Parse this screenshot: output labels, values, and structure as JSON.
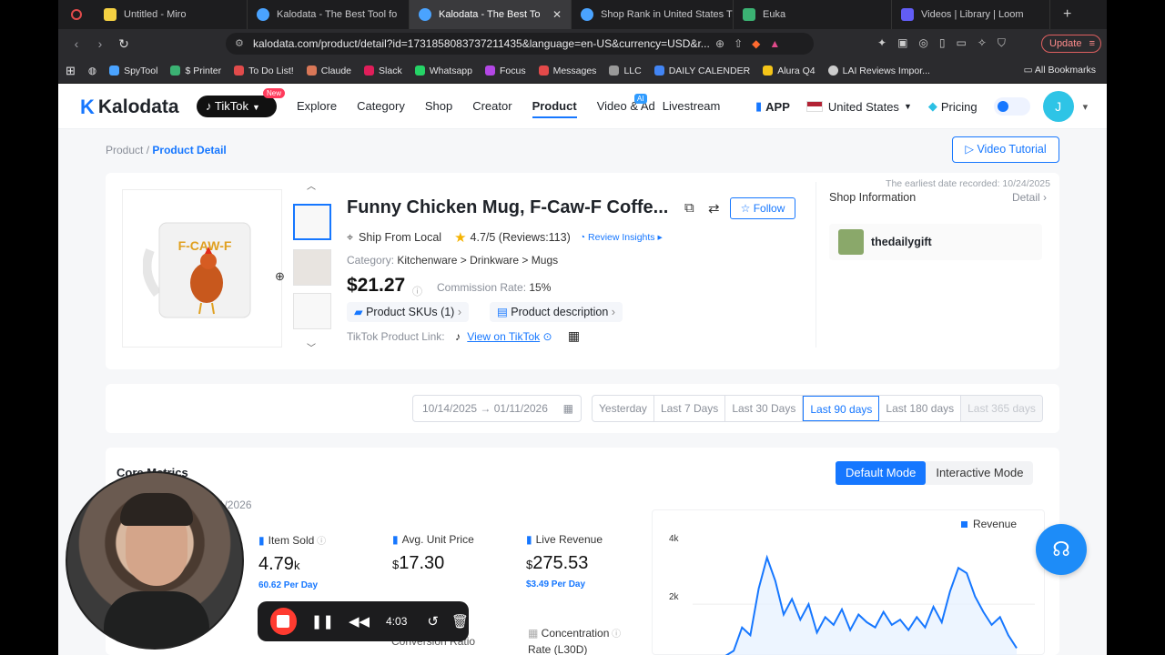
{
  "browser": {
    "tabs": [
      {
        "title": "Untitled - Miro",
        "color": "#f5d142"
      },
      {
        "title": "Kalodata - The Best Tool fo",
        "color": "#4aa3ff"
      },
      {
        "title": "Kalodata - The Best To",
        "color": "#4aa3ff",
        "active": true
      },
      {
        "title": "Shop Rank in United States Ti",
        "color": "#4aa3ff"
      },
      {
        "title": "Euka",
        "color": "#3bb273"
      },
      {
        "title": "Videos | Library | Loom",
        "color": "#625df5"
      }
    ],
    "new_tab": "+",
    "url": "kalodata.com/product/detail?id=1731858083737211435&language=en-US&currency=USD&r...",
    "update_label": "Update",
    "bookmarks": [
      {
        "label": "SpyTool",
        "color": "#4aa3ff"
      },
      {
        "label": "$ Printer",
        "color": "#3bb273"
      },
      {
        "label": "To Do List!",
        "color": "#e14b4b"
      },
      {
        "label": "Claude",
        "color": "#d97757"
      },
      {
        "label": "Slack",
        "color": "#e01e5a"
      },
      {
        "label": "Whatsapp",
        "color": "#25d366"
      },
      {
        "label": "Focus",
        "color": "#b347e6"
      },
      {
        "label": "Messages",
        "color": "#e34a4a"
      },
      {
        "label": "LLC",
        "color": "#999999"
      },
      {
        "label": "DAILY CALENDER",
        "color": "#4285f4"
      },
      {
        "label": "Alura Q4",
        "color": "#f5c518"
      },
      {
        "label": "LAI Reviews Impor...",
        "color": "#cccccc"
      }
    ],
    "all_bookmarks": "All Bookmarks"
  },
  "header": {
    "logo": "Kalodata",
    "platform": "TikTok",
    "new_badge": "New",
    "menu": [
      "Explore",
      "Category",
      "Shop",
      "Creator",
      "Product",
      "Video & Ad",
      "Livestream"
    ],
    "active_menu": "Product",
    "ai_badge": "AI",
    "app": "APP",
    "country": "United States",
    "pricing": "Pricing",
    "avatar_letter": "J"
  },
  "breadcrumb": {
    "root": "Product",
    "sep": "/",
    "current": "Product Detail"
  },
  "video_tutorial": "Video Tutorial",
  "product": {
    "earliest": "The earliest date recorded: 10/24/2025",
    "title": "Funny Chicken Mug, F-Caw-F Coffe...",
    "follow": "Follow",
    "ship_from": "Ship From Local",
    "rating": "4.7/5 (Reviews:113)",
    "review_insights": "Review Insights",
    "category_label": "Category:",
    "category": "Kitchenware > Drinkware > Mugs",
    "price": "$21.27",
    "commission_label": "Commission Rate:",
    "commission": "15%",
    "skus": "Product SKUs (1)",
    "description": "Product description",
    "tiktok_link_label": "TikTok Product Link:",
    "tiktok_link": "View on TikTok",
    "mug_text": "F-CAW-F"
  },
  "shop": {
    "label": "Shop Information",
    "detail": "Detail",
    "name": "thedailygift"
  },
  "dates": {
    "range": "10/14/2025 → 01/11/2026",
    "options": [
      "Yesterday",
      "Last 7 Days",
      "Last 30 Days",
      "Last 90 days",
      "Last 180 days",
      "Last 365 days"
    ],
    "selected": "Last 90 days"
  },
  "metrics": {
    "title": "Core Metrics",
    "date_sub": "11/2026",
    "modes": [
      "Default Mode",
      "Interactive Mode"
    ],
    "item_sold": {
      "label": "Item Sold",
      "value": "4.79",
      "unit": "k",
      "sub": "60.62 Per Day"
    },
    "avg_price": {
      "label": "Avg. Unit Price",
      "value": "17.30",
      "currency": "$"
    },
    "live_revenue": {
      "label": "Live Revenue",
      "value": "275.53",
      "currency": "$",
      "sub": "$3.49 Per Day"
    },
    "concentration": {
      "label": "Concentration",
      "label2": "Rate (L30D)"
    },
    "conversion": "Conversion Ratio",
    "chart": {
      "legend": "Revenue",
      "ticks": [
        "4k",
        "2k"
      ],
      "color": "#1677ff"
    }
  },
  "recorder": {
    "time": "4:03"
  },
  "chart_data": {
    "type": "line",
    "series": [
      {
        "name": "Revenue",
        "values": [
          0,
          200,
          1100,
          800,
          2600,
          3800,
          2900,
          1600,
          2200,
          1400,
          2000,
          900,
          1500,
          1200,
          1800,
          1000,
          1600,
          1300,
          1100,
          1700,
          1200,
          1400,
          1000,
          1500,
          1100,
          1900,
          1300,
          2500,
          3400,
          3200,
          2300,
          1700,
          1200,
          1500,
          800,
          300
        ]
      }
    ],
    "ylim": [
      0,
      4500
    ],
    "ytick_labels": [
      "4k",
      "2k"
    ],
    "title": "",
    "xlabel": "",
    "ylabel": ""
  }
}
